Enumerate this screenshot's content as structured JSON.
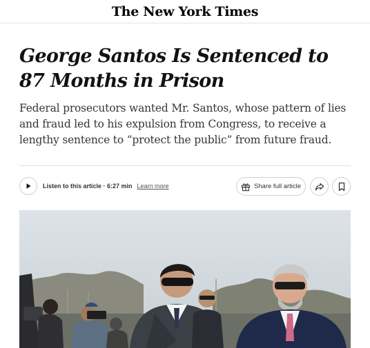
{
  "masthead": {
    "logo_text": "The New York Times"
  },
  "article": {
    "headline": "George Santos Is Sentenced to 87 Months in Prison",
    "summary": "Federal prosecutors wanted Mr. Santos, whose pattern of lies and fraud led to his expulsion from Congress, to receive a lengthy sentence to “protect the public” from future fraud."
  },
  "audio": {
    "listen_label": "Listen to this article · 6:27 min",
    "learn_more": "Learn more"
  },
  "actions": {
    "share_label": "Share full article"
  },
  "icons": {
    "play": "play-icon",
    "gift": "gift-icon",
    "forward": "forward-arrow-icon",
    "bookmark": "bookmark-icon"
  },
  "colors": {
    "text": "#121212",
    "summary": "#363636",
    "border": "#cfcfcf"
  }
}
